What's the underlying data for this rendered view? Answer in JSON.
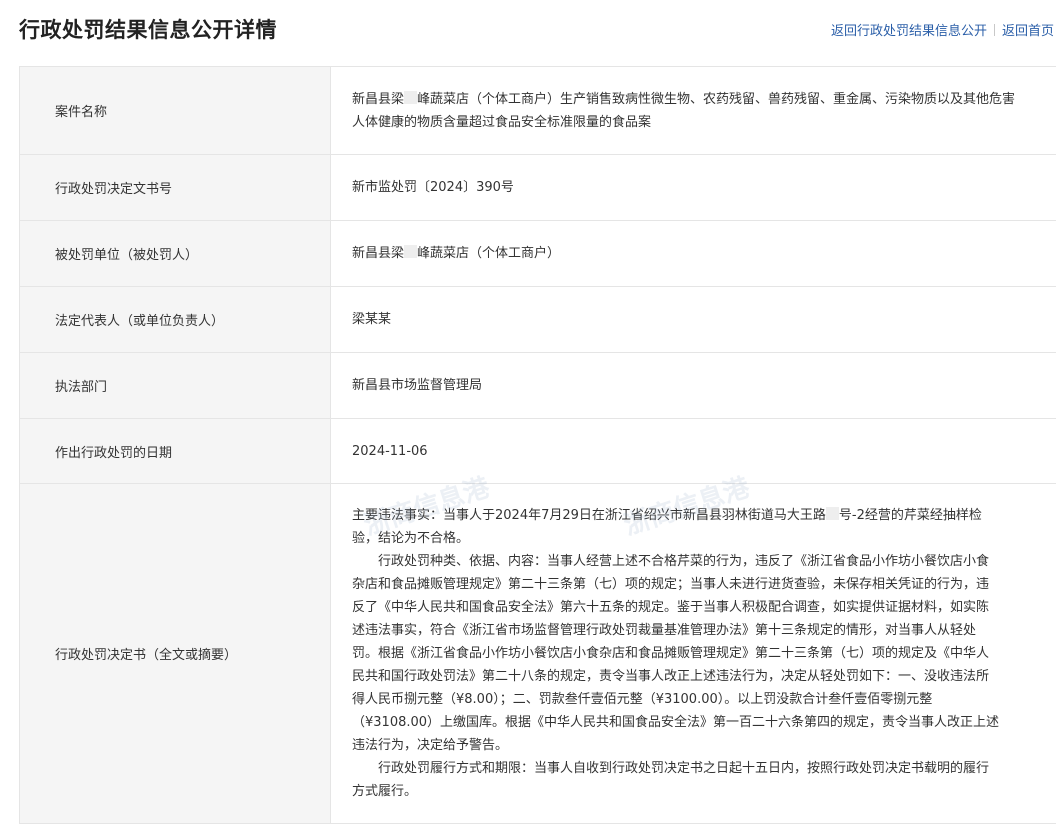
{
  "header": {
    "title": "行政处罚结果信息公开详情",
    "link_back_list": "返回行政处罚结果信息公开",
    "link_home": "返回首页"
  },
  "rows": {
    "case_name": {
      "label": "案件名称",
      "value_part1": "新昌县梁",
      "value_part2": "峰蔬菜店（个体工商户）生产销售致病性微生物、农药残留、兽药残留、重金属、污染物质以及其他危害人体健康的物质含量超过食品安全标准限量的食品案"
    },
    "decision_no": {
      "label": "行政处罚决定文书号",
      "value": "新市监处罚〔2024〕390号"
    },
    "party": {
      "label": "被处罚单位（被处罚人）",
      "value_part1": "新昌县梁",
      "value_part2": "峰蔬菜店（个体工商户）"
    },
    "legal_rep": {
      "label": "法定代表人（或单位负责人）",
      "value": "梁某某"
    },
    "dept": {
      "label": "执法部门",
      "value": "新昌县市场监督管理局"
    },
    "date": {
      "label": "作出行政处罚的日期",
      "value": "2024-11-06"
    },
    "decision": {
      "label": "行政处罚决定书（全文或摘要）",
      "p1_part1": "主要违法事实：当事人于2024年7月29日在浙江省绍兴市新昌县羽林街道马大王路",
      "p1_part2": "号-2经营的芹菜经抽样检验，结论为不合格。",
      "p2": "行政处罚种类、依据、内容：当事人经营上述不合格芹菜的行为，违反了《浙江省食品小作坊小餐饮店小食杂店和食品摊贩管理规定》第二十三条第（七）项的规定；当事人未进行进货查验，未保存相关凭证的行为，违反了《中华人民共和国食品安全法》第六十五条的规定。鉴于当事人积极配合调查，如实提供证据材料，如实陈述违法事实，符合《浙江省市场监督管理行政处罚裁量基准管理办法》第十三条规定的情形，对当事人从轻处罚。根据《浙江省食品小作坊小餐饮店小食杂店和食品摊贩管理规定》第二十三条第（七）项的规定及《中华人民共和国行政处罚法》第二十八条的规定，责令当事人改正上述违法行为，决定从轻处罚如下：一、没收违法所得人民币捌元整（¥8.00）；二、罚款叁仟壹佰元整（¥3100.00）。以上罚没款合计叁仟壹佰零捌元整（¥3108.00）上缴国库。根据《中华人民共和国食品安全法》第一百二十六条第四的规定，责令当事人改正上述违法行为，决定给予警告。",
      "p3": "行政处罚履行方式和期限：当事人自收到行政处罚决定书之日起十五日内，按照行政处罚决定书载明的履行方式履行。"
    }
  },
  "watermark_text": "浙商信息港"
}
